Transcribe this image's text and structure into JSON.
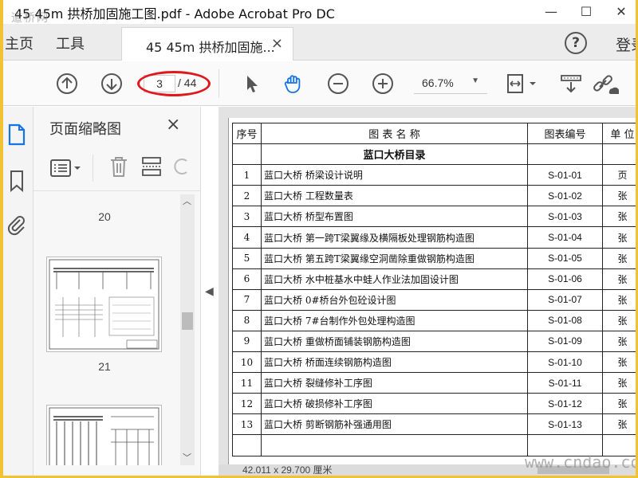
{
  "window": {
    "title": "45 45m 拱桥加固施工图.pdf - Adobe Acrobat Pro DC",
    "watermark_top": "道桥网",
    "watermark_bottom": "www.cndao.com"
  },
  "tabs": {
    "home": "主页",
    "tools": "工具",
    "doc": "45 45m 拱桥加固施...",
    "doc_close": "×",
    "help": "?",
    "login": "登录"
  },
  "toolbar": {
    "page_current": "3",
    "page_total": "/ 44",
    "zoom": "66.7%"
  },
  "thumbnails": {
    "title": "页面缩略图",
    "close": "×",
    "pages": [
      "20",
      "21"
    ]
  },
  "toc": {
    "headers": {
      "no": "序号",
      "name": "图 表 名 称",
      "code": "图表编号",
      "unit": "单 位"
    },
    "section_title": "蓝口大桥目录",
    "rows": [
      {
        "no": "1",
        "name": "蓝口大桥 桥梁设计说明",
        "code": "S-01-01",
        "unit": "页"
      },
      {
        "no": "2",
        "name": "蓝口大桥 工程数量表",
        "code": "S-01-02",
        "unit": "张"
      },
      {
        "no": "3",
        "name": "蓝口大桥 桥型布置图",
        "code": "S-01-03",
        "unit": "张"
      },
      {
        "no": "4",
        "name": "蓝口大桥 第一跨T梁翼缘及横隔板处理钢筋构造图",
        "code": "S-01-04",
        "unit": "张"
      },
      {
        "no": "5",
        "name": "蓝口大桥 第五跨T梁翼缘空洞凿除重做钢筋构造图",
        "code": "S-01-05",
        "unit": "张"
      },
      {
        "no": "6",
        "name": "蓝口大桥 水中桩基水中蛙人作业法加固设计图",
        "code": "S-01-06",
        "unit": "张"
      },
      {
        "no": "7",
        "name": "蓝口大桥 0#桥台外包砼设计图",
        "code": "S-01-07",
        "unit": "张"
      },
      {
        "no": "8",
        "name": "蓝口大桥 7#台制作外包处理构造图",
        "code": "S-01-08",
        "unit": "张"
      },
      {
        "no": "9",
        "name": "蓝口大桥 重做桥面铺装钢筋构造图",
        "code": "S-01-09",
        "unit": "张"
      },
      {
        "no": "10",
        "name": "蓝口大桥 桥面连续钢筋构造图",
        "code": "S-01-10",
        "unit": "张"
      },
      {
        "no": "11",
        "name": "蓝口大桥 裂缝修补工序图",
        "code": "S-01-11",
        "unit": "张"
      },
      {
        "no": "12",
        "name": "蓝口大桥 破损修补工序图",
        "code": "S-01-12",
        "unit": "张"
      },
      {
        "no": "13",
        "name": "蓝口大桥 剪断钢筋补强通用图",
        "code": "S-01-13",
        "unit": "张"
      }
    ]
  },
  "status": {
    "dimensions": "42.011 x 29.700 厘米"
  },
  "colors": {
    "frame": "#f1c232",
    "accent_blue": "#1473e6",
    "annotation_red": "#e0171d"
  }
}
